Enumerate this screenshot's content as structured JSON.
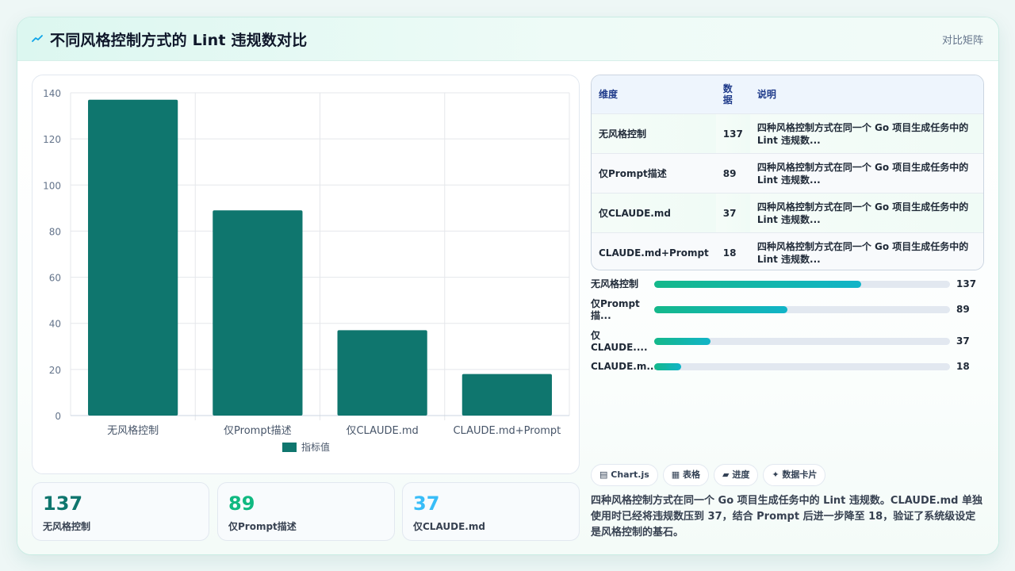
{
  "header": {
    "title": "不同风格控制方式的 Lint 违规数对比",
    "tag": "对比矩阵"
  },
  "chart_data": {
    "type": "bar",
    "categories": [
      "无风格控制",
      "仅Prompt描述",
      "仅CLAUDE.md",
      "CLAUDE.md+Prompt"
    ],
    "series": [
      {
        "name": "指标值",
        "values": [
          137,
          89,
          37,
          18
        ]
      }
    ],
    "ylim": [
      0,
      140
    ],
    "yticks": [
      0,
      20,
      40,
      60,
      80,
      100,
      120,
      140
    ],
    "legend": "bottom",
    "grid": true,
    "color": "#0f766e"
  },
  "stats": [
    {
      "value": "137",
      "label": "无风格控制",
      "color": "#0f766e"
    },
    {
      "value": "89",
      "label": "仅Prompt描述",
      "color": "#10b981"
    },
    {
      "value": "37",
      "label": "仅CLAUDE.md",
      "color": "#38bdf8"
    }
  ],
  "table": {
    "headers": [
      "维度",
      "数据",
      "说明"
    ],
    "header_data_lines": [
      "数",
      "据"
    ],
    "rows": [
      {
        "dim": "无风格控制",
        "val": "137",
        "note": "四种风格控制方式在同一个 Go 项目生成任务中的 Lint 违规数..."
      },
      {
        "dim": "仅Prompt描述",
        "val": "89",
        "note": "四种风格控制方式在同一个 Go 项目生成任务中的 Lint 违规数..."
      },
      {
        "dim": "仅CLAUDE.md",
        "val": "37",
        "note": "四种风格控制方式在同一个 Go 项目生成任务中的 Lint 违规数..."
      },
      {
        "dim": "CLAUDE.md+Prompt",
        "val": "18",
        "note": "四种风格控制方式在同一个 Go 项目生成任务中的 Lint 违规数..."
      }
    ]
  },
  "progress": {
    "max": 137,
    "items": [
      {
        "label": "无风格控制",
        "value": 137,
        "fraction": 0.7
      },
      {
        "label": "仅Prompt 描...",
        "value": 89,
        "fraction": 0.45
      },
      {
        "label": "仅 CLAUDE....",
        "value": 37,
        "fraction": 0.19
      },
      {
        "label": "CLAUDE.m...",
        "value": 18,
        "fraction": 0.09
      }
    ]
  },
  "chips": [
    {
      "icon": "chart-icon",
      "label": "Chart.js"
    },
    {
      "icon": "table-icon",
      "label": "表格"
    },
    {
      "icon": "progress-icon",
      "label": "进度"
    },
    {
      "icon": "sparkle-icon",
      "label": "数据卡片"
    }
  ],
  "description": "四种风格控制方式在同一个 Go 项目生成任务中的 Lint 违规数。CLAUDE.md 单独使用时已经将违规数压到 37，结合 Prompt 后进一步降至 18，验证了系统级设定是风格控制的基石。"
}
